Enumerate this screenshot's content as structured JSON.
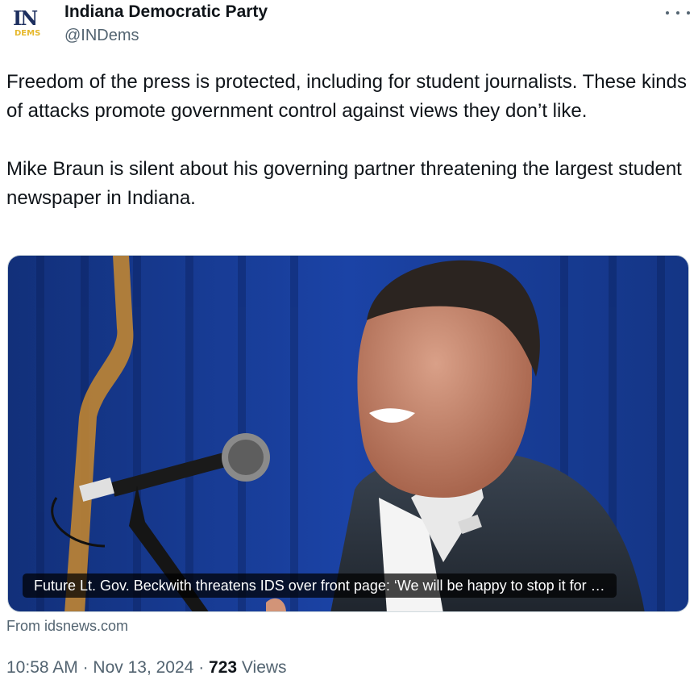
{
  "author": {
    "name": "Indiana Democratic Party",
    "handle": "@INDems",
    "avatar_text_top": "IN",
    "avatar_text_bottom": "DEMS"
  },
  "tweet": {
    "text": "Freedom of the press is protected, including for student journalists. These kinds of attacks promote government control against views they don’t like.\n\nMike Braun is silent about his governing partner threatening the largest student newspaper in Indiana."
  },
  "link_card": {
    "caption": "Future Lt. Gov. Beckwith threatens IDS over front page: ‘We will be happy to stop it for …",
    "source": "From idsnews.com"
  },
  "meta": {
    "time": "10:58 AM",
    "date": "Nov 13, 2024",
    "views_count": "723",
    "views_label": "Views"
  },
  "icons": {
    "more": "more-horizontal-icon"
  },
  "colors": {
    "text_primary": "#0f1419",
    "text_secondary": "#536471",
    "curtain_blue": "#1b3a8a"
  }
}
